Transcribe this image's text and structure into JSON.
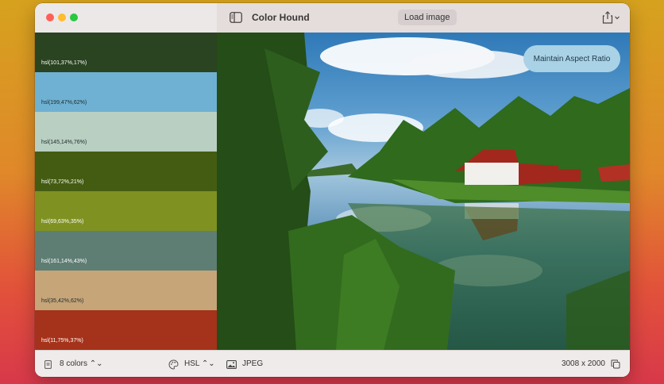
{
  "window": {
    "title": "Color Hound",
    "traffic_lights": [
      "close",
      "minimize",
      "zoom"
    ],
    "load_button_label": "Load image",
    "share_icon": "share-icon",
    "sidebar_toggle_icon": "sidebar-toggle-icon"
  },
  "swatches": [
    {
      "label": "hsl(101,37%,17%)",
      "color": "#2a4320"
    },
    {
      "label": "hsl(199,47%,62%)",
      "color": "#6fb1d3"
    },
    {
      "label": "hsl(145,14%,76%)",
      "color": "#b8cfc1"
    },
    {
      "label": "hsl(73,72%,21%)",
      "color": "#445c12"
    },
    {
      "label": "hsl(69,63%,35%)",
      "color": "#7f9121"
    },
    {
      "label": "hsl(161,14%,43%)",
      "color": "#5e7d73"
    },
    {
      "label": "hsl(35,42%,62%)",
      "color": "#c6a579"
    },
    {
      "label": "hsl(11,75%,37%)",
      "color": "#a5321a"
    }
  ],
  "sidebar_footer": {
    "count_label": "8 colors ⌃⌄",
    "format_label": "HSL ⌃⌄",
    "palette_icon": "palette-icon",
    "count_icon": "document-icon"
  },
  "canvas": {
    "aspect_toggle_label": "Maintain Aspect Ratio",
    "image_description_icon": "landscape-photo"
  },
  "footer": {
    "format": "JPEG",
    "dimensions": "3008 x 2000",
    "image_icon": "photo-icon",
    "copy_icon": "copy-icon"
  }
}
